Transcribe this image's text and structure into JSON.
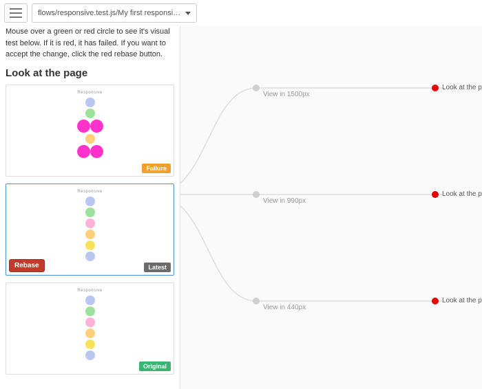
{
  "dropdown": {
    "label": "flows/responsive.test.js/My first responsiv..."
  },
  "instructions": "Mouse over a green or red circle to see it's visual test below. If it is red, it has failed. If you want to accept the change, click the red rebase button.",
  "section_title": "Look at the page",
  "cards": {
    "failure": {
      "badge": "Failure",
      "thumb_title": "Responsive"
    },
    "latest": {
      "badge": "Latest",
      "thumb_title": "Responsive",
      "rebase": "Rebase"
    },
    "original": {
      "badge": "Original",
      "thumb_title": "Responsive"
    }
  },
  "graph": {
    "branches": [
      {
        "label": "View in 1500px",
        "leaf": "Look at the page"
      },
      {
        "label": "View in 990px",
        "leaf": "Look at the page"
      },
      {
        "label": "View in 440px",
        "leaf": "Look at the page"
      }
    ]
  },
  "colors": {
    "c1": "#b8c6f0",
    "c2": "#9be29b",
    "c3": "#ffcf7a",
    "c4": "#ffb0d8",
    "c5": "#ff33cc",
    "c6": "#f9e15b"
  }
}
